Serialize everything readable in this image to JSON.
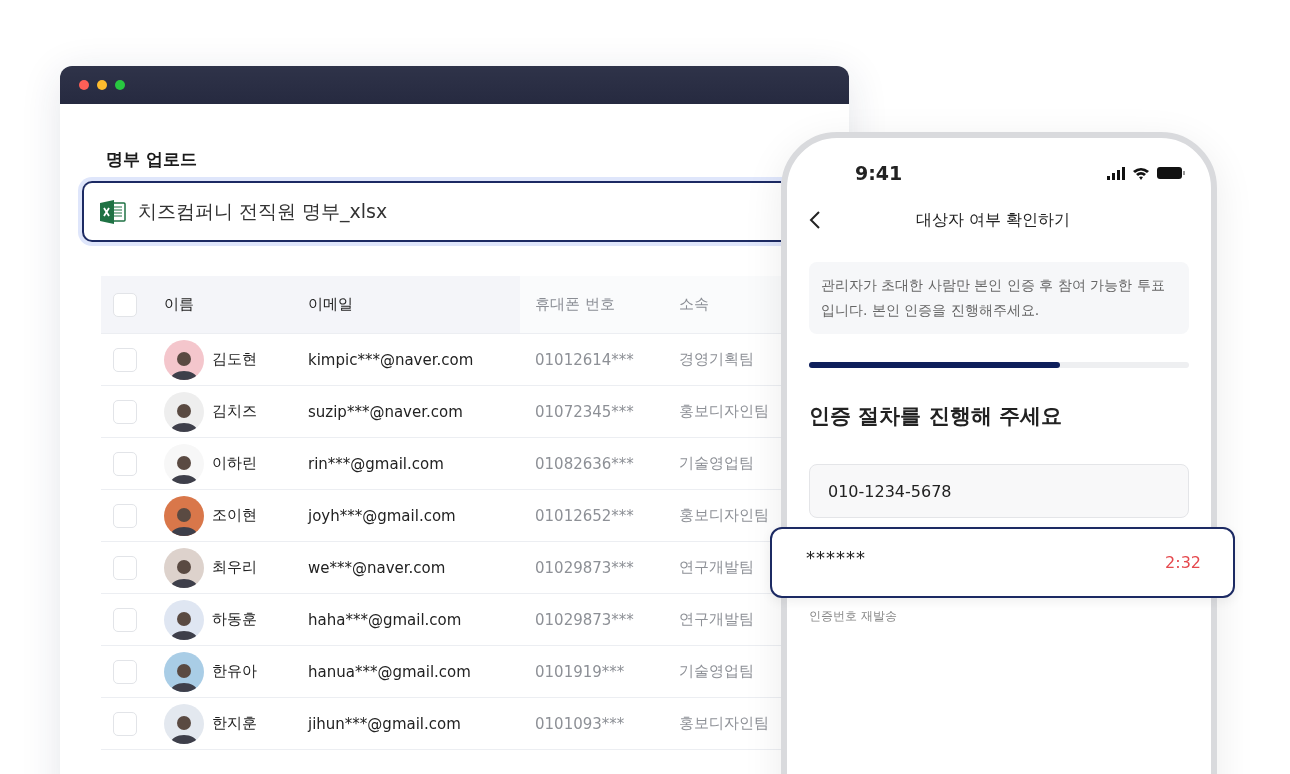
{
  "upload": {
    "label": "명부 업로드",
    "file_name": "치즈컴퍼니 전직원 명부_xlsx"
  },
  "table": {
    "columns": [
      "이름",
      "이메일",
      "휴대폰 번호",
      "소속"
    ],
    "select_all": {
      "checked": false
    },
    "rows": [
      {
        "checked": false,
        "color": "#f4c6cc",
        "name": "김도현",
        "email": "kimpic***@naver.com",
        "phone": "01012614***",
        "team": "경영기획팀"
      },
      {
        "checked": false,
        "color": "#eeeeee",
        "name": "김치즈",
        "email": "suzip***@naver.com",
        "phone": "01072345***",
        "team": "홍보디자인팀"
      },
      {
        "checked": false,
        "color": "#f7f7f7",
        "name": "이하린",
        "email": "rin***@gmail.com",
        "phone": "01082636***",
        "team": "기술영업팀"
      },
      {
        "checked": false,
        "color": "#d9774a",
        "name": "조이현",
        "email": "joyh***@gmail.com",
        "phone": "01012652***",
        "team": "홍보디자인팀"
      },
      {
        "checked": false,
        "color": "#ddd2cc",
        "name": "최우리",
        "email": "we***@naver.com",
        "phone": "01029873***",
        "team": "연구개발팀"
      },
      {
        "checked": false,
        "color": "#dfe6f2",
        "name": "하동훈",
        "email": "haha***@gmail.com",
        "phone": "01029873***",
        "team": "연구개발팀"
      },
      {
        "checked": false,
        "color": "#a9cde6",
        "name": "한유아",
        "email": "hanua***@gmail.com",
        "phone": "0101919***",
        "team": "기술영업팀"
      },
      {
        "checked": false,
        "color": "#e3e8ef",
        "name": "한지훈",
        "email": "jihun***@gmail.com",
        "phone": "0101093***",
        "team": "홍보디자인팀"
      }
    ]
  },
  "phone": {
    "status_bar": {
      "time": "9:41"
    },
    "header": {
      "title": "대상자 여부 확인하기"
    },
    "notice": "관리자가 초대한 사람만 본인 인증 후 참여 가능한 투표입니다. 본인 인증을 진행해주세요.",
    "progress": {
      "level": 0.66
    },
    "heading": "인증 절차를 진행해 주세요",
    "phone_field": {
      "value": "010-1234-5678"
    },
    "code_field": {
      "value": "******",
      "timer": "2:32"
    },
    "resend_link": "인증번호 재발송"
  }
}
